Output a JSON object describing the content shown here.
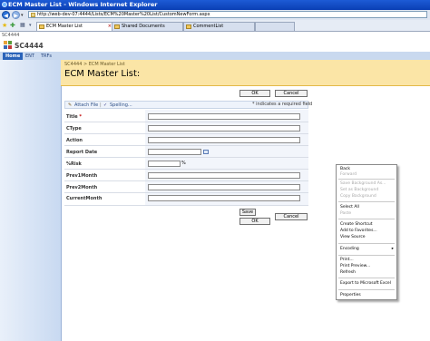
{
  "window": {
    "title": "ECM Master List - Windows Internet Explorer"
  },
  "browser": {
    "url": "http://web-dev-07:4444/Lists/ECM%20Master%20List/CustomNewForm.aspx",
    "tabs": [
      {
        "label": "ECM Master List"
      },
      {
        "label": "Shared Documents"
      },
      {
        "label": "CommentList"
      }
    ]
  },
  "site": {
    "crumb": "SC4444",
    "name": "SC4444",
    "nav": [
      {
        "label": "Home"
      },
      {
        "label": "ENT"
      },
      {
        "label": "TRFs"
      }
    ]
  },
  "page": {
    "breadcrumb": "SC4444 > ECM Master List",
    "title": "ECM Master List:"
  },
  "buttons": {
    "ok": "OK",
    "cancel": "Cancel",
    "save": "Save"
  },
  "toolbar": {
    "attach": "Attach File",
    "spelling": "Spelling...",
    "required_note": "* indicates a required field"
  },
  "form": {
    "fields": [
      {
        "label": "Title",
        "required": "*"
      },
      {
        "label": "CType"
      },
      {
        "label": "Action"
      },
      {
        "label": "Report Date"
      },
      {
        "label": "%Risk",
        "suffix": "%"
      },
      {
        "label": "Prev1Month"
      },
      {
        "label": "Prev2Month"
      },
      {
        "label": "CurrentMonth"
      }
    ]
  },
  "context_menu": {
    "items": [
      {
        "label": "Back",
        "enabled": true
      },
      {
        "label": "Forward",
        "enabled": false
      },
      {
        "label": "Save Background As...",
        "enabled": false
      },
      {
        "label": "Set as Background",
        "enabled": false
      },
      {
        "label": "Copy Background",
        "enabled": false
      },
      {
        "label": "Select All",
        "enabled": true
      },
      {
        "label": "Paste",
        "enabled": false
      },
      {
        "label": "Create Shortcut",
        "enabled": true
      },
      {
        "label": "Add to Favorites...",
        "enabled": true
      },
      {
        "label": "View Source",
        "enabled": true
      },
      {
        "label": "Encoding",
        "enabled": true
      },
      {
        "label": "Print...",
        "enabled": true
      },
      {
        "label": "Print Preview...",
        "enabled": true
      },
      {
        "label": "Refresh",
        "enabled": true
      },
      {
        "label": "Export to Microsoft Excel",
        "enabled": true
      },
      {
        "label": "Properties",
        "enabled": true
      }
    ]
  },
  "colors": {
    "title_bar": "#0a3fb4",
    "title_area": "#fbe5a6",
    "left_nav": "#c8d9f1",
    "selected_nav": "#2a63b9"
  }
}
